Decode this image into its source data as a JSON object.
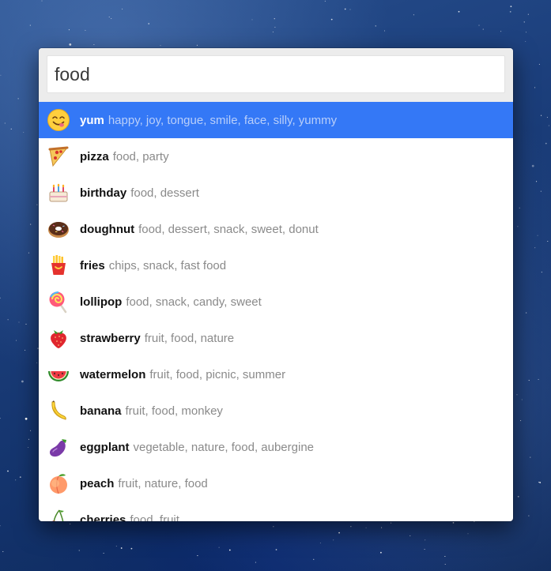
{
  "search": {
    "value": "food"
  },
  "results": [
    {
      "name": "yum",
      "keywords": "happy, joy, tongue, smile, face, silly, yummy",
      "icon": "yum-face-icon",
      "selected": true
    },
    {
      "name": "pizza",
      "keywords": "food, party",
      "icon": "pizza-icon",
      "selected": false
    },
    {
      "name": "birthday",
      "keywords": "food, dessert",
      "icon": "birthday-cake-icon",
      "selected": false
    },
    {
      "name": "doughnut",
      "keywords": "food, dessert, snack, sweet, donut",
      "icon": "doughnut-icon",
      "selected": false
    },
    {
      "name": "fries",
      "keywords": "chips, snack, fast food",
      "icon": "fries-icon",
      "selected": false
    },
    {
      "name": "lollipop",
      "keywords": "food, snack, candy, sweet",
      "icon": "lollipop-icon",
      "selected": false
    },
    {
      "name": "strawberry",
      "keywords": "fruit, food, nature",
      "icon": "strawberry-icon",
      "selected": false
    },
    {
      "name": "watermelon",
      "keywords": "fruit, food, picnic, summer",
      "icon": "watermelon-icon",
      "selected": false
    },
    {
      "name": "banana",
      "keywords": "fruit, food, monkey",
      "icon": "banana-icon",
      "selected": false
    },
    {
      "name": "eggplant",
      "keywords": "vegetable, nature, food, aubergine",
      "icon": "eggplant-icon",
      "selected": false
    },
    {
      "name": "peach",
      "keywords": "fruit, nature, food",
      "icon": "peach-icon",
      "selected": false
    },
    {
      "name": "cherries",
      "keywords": "food, fruit",
      "icon": "cherries-icon",
      "selected": false
    }
  ],
  "colors": {
    "selection": "#3478f6",
    "background": "#1c3f7c"
  }
}
